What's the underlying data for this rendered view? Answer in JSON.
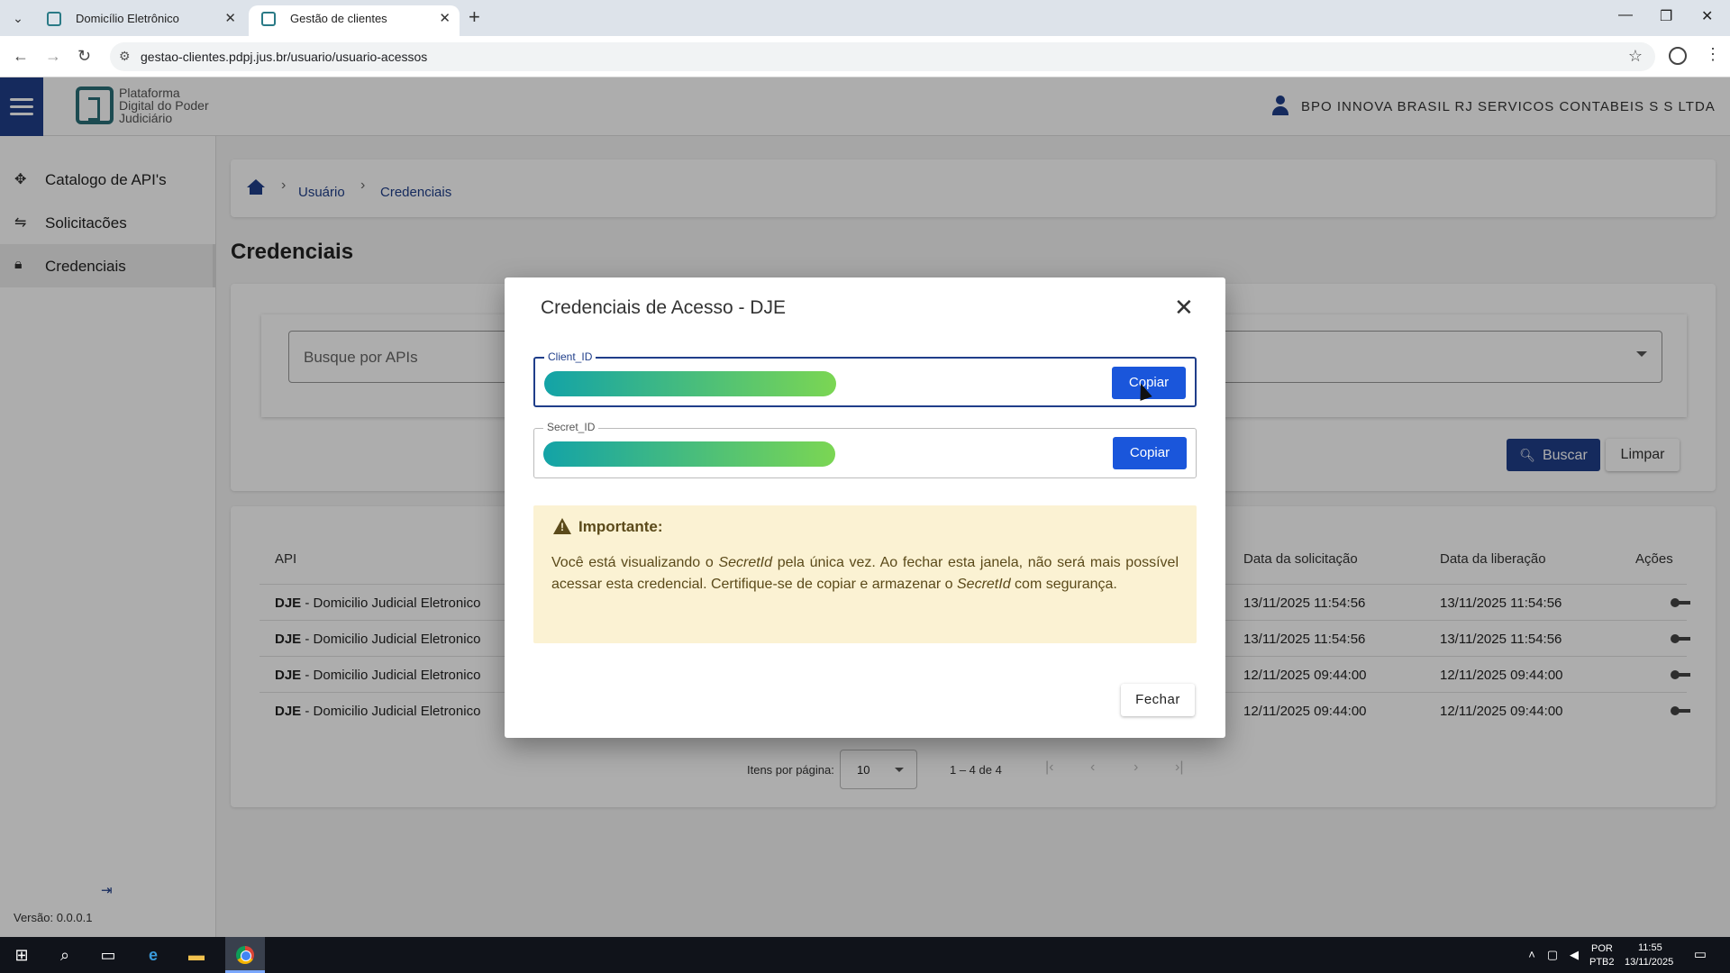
{
  "browser": {
    "tabs": [
      {
        "label": "Domicílio Eletrônico",
        "active": false
      },
      {
        "label": "Gestão de clientes",
        "active": true
      }
    ],
    "url": "gestao-clientes.pdpj.jus.br/usuario/usuario-acessos"
  },
  "header": {
    "logo_text": "Plataforma Digital do Poder Judiciário",
    "user_name": "BPO INNOVA BRASIL RJ SERVICOS CONTABEIS S S LTDA"
  },
  "sidebar": {
    "items": [
      {
        "label": "Catalogo de API's",
        "icon": "api-catalog-icon"
      },
      {
        "label": "Solicitacões",
        "icon": "requests-icon"
      },
      {
        "label": "Credenciais",
        "icon": "lock-icon",
        "active": true
      }
    ],
    "version": "Versão: 0.0.0.1"
  },
  "breadcrumb": {
    "items": [
      "Usuário",
      "Credenciais"
    ]
  },
  "page": {
    "title": "Credenciais"
  },
  "search": {
    "placeholder": "Busque por APIs",
    "buscar_label": "Buscar",
    "limpar_label": "Limpar"
  },
  "table": {
    "headers": {
      "api": "API",
      "data_solicitacao": "Data da solicitação",
      "data_liberacao": "Data da liberação",
      "acoes": "Ações"
    },
    "rows": [
      {
        "api_code": "DJE",
        "api_name": " - Domicilio Judicial Eletronico",
        "solicitacao": "13/11/2025 11:54:56",
        "liberacao": "13/11/2025 11:54:56"
      },
      {
        "api_code": "DJE",
        "api_name": " - Domicilio Judicial Eletronico",
        "solicitacao": "13/11/2025 11:54:56",
        "liberacao": "13/11/2025 11:54:56"
      },
      {
        "api_code": "DJE",
        "api_name": " - Domicilio Judicial Eletronico",
        "solicitacao": "12/11/2025 09:44:00",
        "liberacao": "12/11/2025 09:44:00"
      },
      {
        "api_code": "DJE",
        "api_name": " - Domicilio Judicial Eletronico",
        "solicitacao": "12/11/2025 09:44:00",
        "liberacao": "12/11/2025 09:44:00"
      }
    ]
  },
  "pagination": {
    "label": "Itens por página:",
    "page_size": "10",
    "range": "1 – 4 de 4"
  },
  "modal": {
    "title": "Credenciais de Acesso - DJE",
    "client_id_label": "Client_ID",
    "secret_id_label": "Secret_ID",
    "copy_label": "Copiar",
    "important_title": "Importante:",
    "important_p1": "Você está visualizando o ",
    "important_secret1": "SecretId",
    "important_p2": " pela única vez. Ao fechar esta janela, não será mais possível acessar esta credencial. Certifique-se de copiar e armazenar o ",
    "important_secret2": "SecretId",
    "important_p3": " com segurança.",
    "fechar_label": "Fechar"
  },
  "taskbar": {
    "lang_1": "POR",
    "lang_2": "PTB2",
    "time": "11:55",
    "date": "13/11/2025"
  },
  "colors": {
    "primary": "#1f3e8a",
    "copy_button": "#1a56db",
    "warning_bg": "#fbf2d3",
    "warning_text": "#5b4a1a"
  }
}
